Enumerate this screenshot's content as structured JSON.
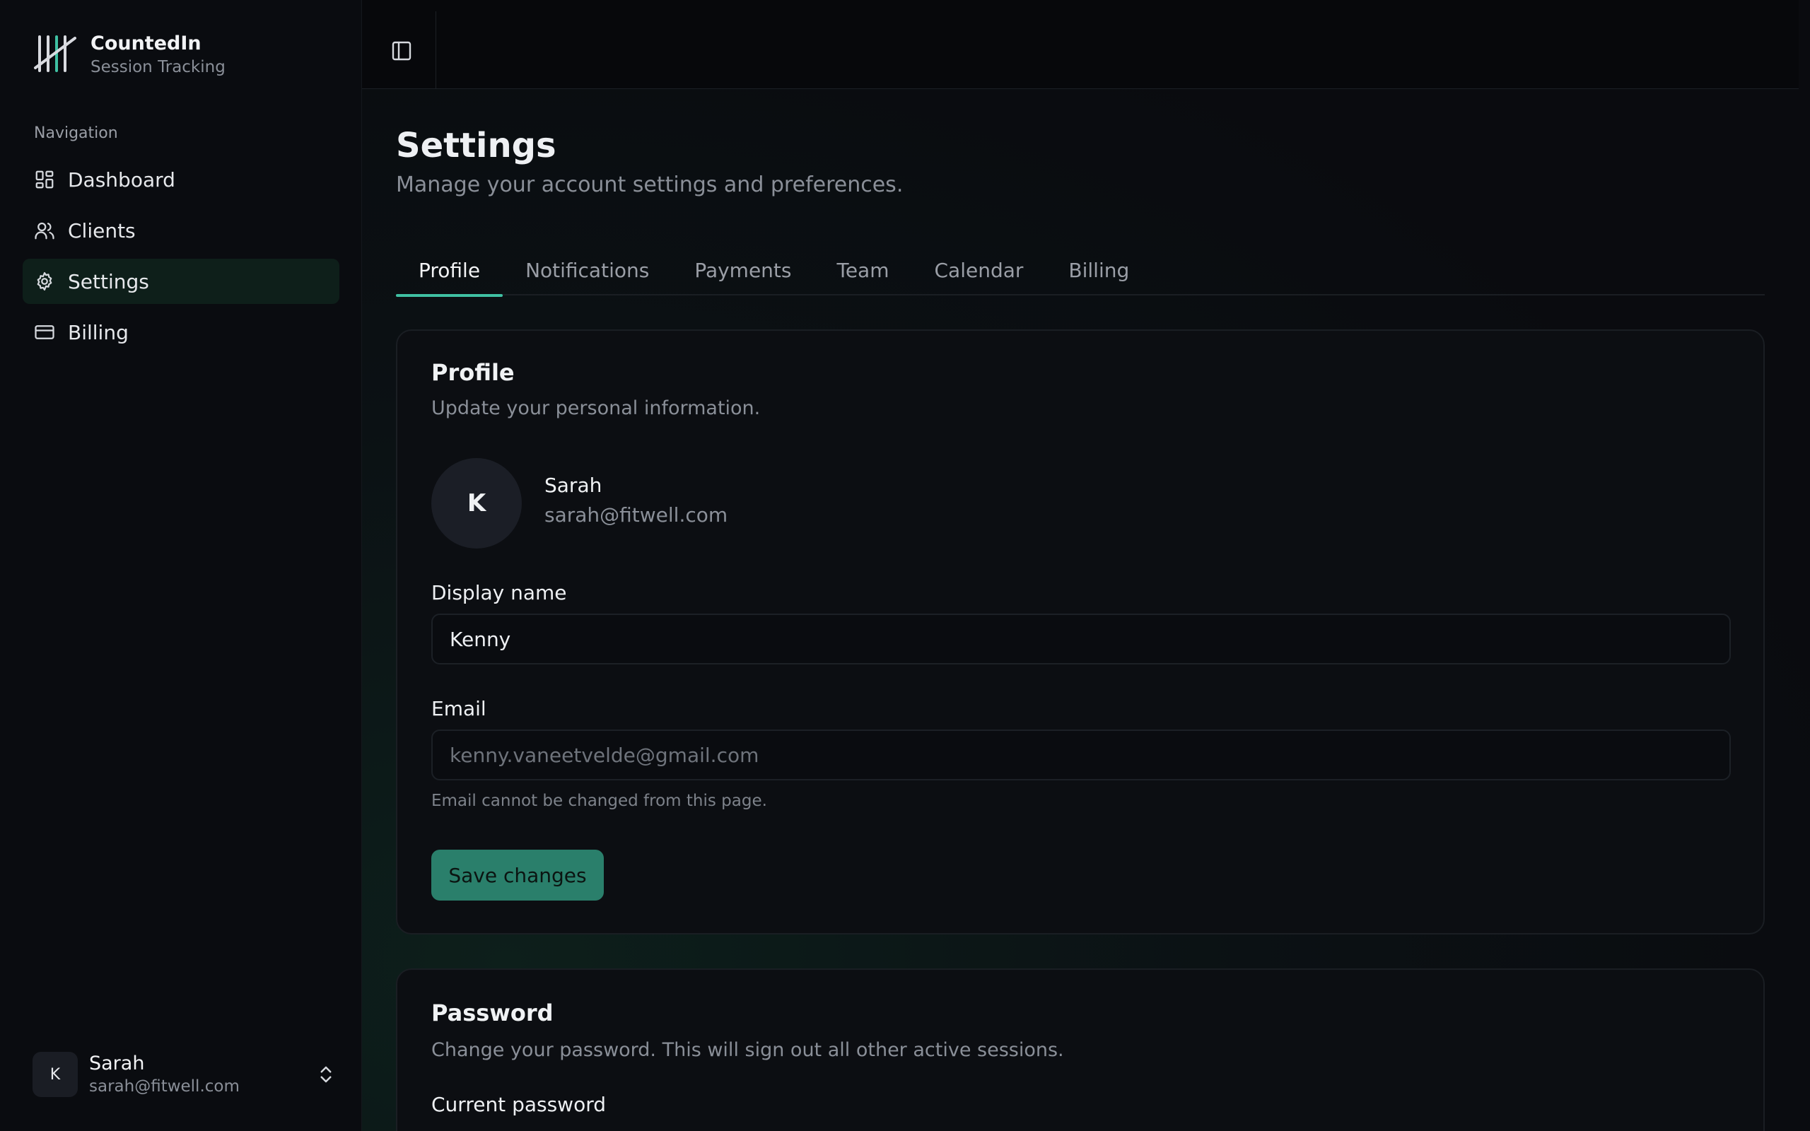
{
  "brand": {
    "name": "CountedIn",
    "subtitle": "Session Tracking"
  },
  "sidebar": {
    "heading": "Navigation",
    "items": [
      {
        "label": "Dashboard",
        "icon": "dashboard-icon"
      },
      {
        "label": "Clients",
        "icon": "users-icon"
      },
      {
        "label": "Settings",
        "icon": "gear-icon",
        "active": true
      },
      {
        "label": "Billing",
        "icon": "credit-card-icon"
      }
    ]
  },
  "user": {
    "initial": "K",
    "name": "Sarah",
    "email": "sarah@fitwell.com"
  },
  "page": {
    "title": "Settings",
    "subtitle": "Manage your account settings and preferences."
  },
  "tabs": [
    "Profile",
    "Notifications",
    "Payments",
    "Team",
    "Calendar",
    "Billing"
  ],
  "active_tab": "Profile",
  "profile_card": {
    "title": "Profile",
    "description": "Update your personal information.",
    "avatar_initial": "K",
    "name": "Sarah",
    "email": "sarah@fitwell.com",
    "display_name_label": "Display name",
    "display_name_value": "Kenny",
    "email_label": "Email",
    "email_value": "kenny.vaneetvelde@gmail.com",
    "email_help": "Email cannot be changed from this page.",
    "save_label": "Save changes"
  },
  "password_card": {
    "title": "Password",
    "description": "Change your password. This will sign out all other active sessions.",
    "current_password_label": "Current password"
  },
  "colors": {
    "accent": "#3fc1a3",
    "button": "#2a7f6b",
    "active_nav_bg": "#0e1f1a"
  }
}
